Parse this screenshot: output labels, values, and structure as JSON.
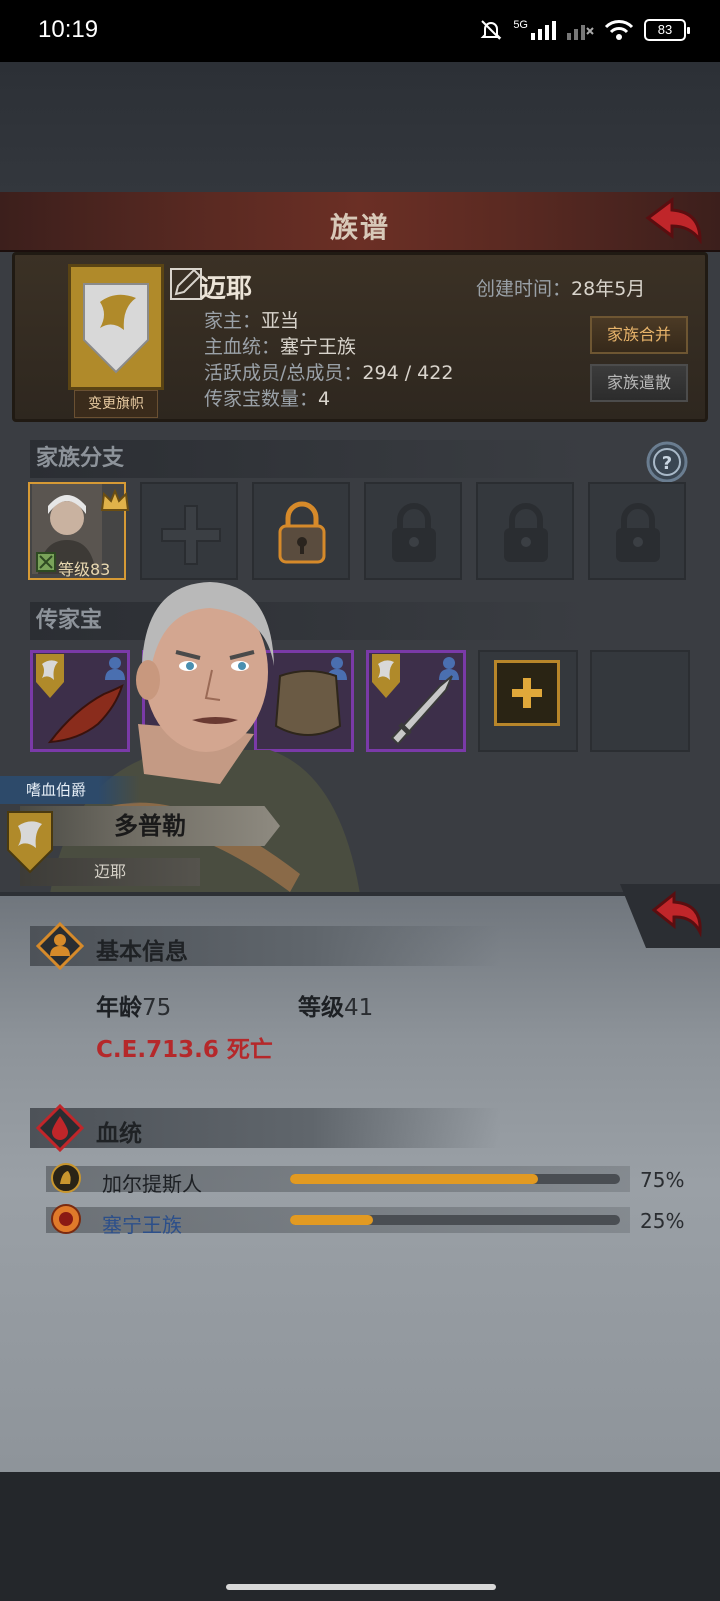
{
  "status_bar": {
    "time": "10:19",
    "network": "5G",
    "battery": "83"
  },
  "header": {
    "title": "族谱"
  },
  "family": {
    "name": "迈耶",
    "change_banner": "变更旗帜",
    "created_label": "创建时间：",
    "created_value": "28年5月",
    "patriarch_label": "家主：",
    "patriarch_value": "亚当",
    "bloodline_label": "主血统：",
    "bloodline_value": "塞宁王族",
    "members_label": "活跃成员/总成员：",
    "members_value": "294 / 422",
    "heirloom_count_label": "传家宝数量：",
    "heirloom_count_value": "4",
    "merge_button": "家族合并",
    "disband_button": "家族遣散"
  },
  "branches": {
    "title": "家族分支",
    "slots": [
      {
        "state": "member",
        "level_label": "等级83"
      },
      {
        "state": "empty"
      },
      {
        "state": "unlockable"
      },
      {
        "state": "locked"
      },
      {
        "state": "locked"
      },
      {
        "state": "locked"
      }
    ]
  },
  "heirlooms": {
    "title": "传家宝",
    "items": [
      "claw-weapon",
      "weapon",
      "armor",
      "sword"
    ]
  },
  "character": {
    "title": "嗜血伯爵",
    "name": "多普勒",
    "family": "迈耶"
  },
  "basic_info": {
    "title": "基本信息",
    "age_label": "年龄",
    "age_value": "75",
    "level_label": "等级",
    "level_value": "41",
    "death_text": "C.E.713.6 死亡"
  },
  "bloodline": {
    "title": "血统",
    "rows": [
      {
        "name": "加尔提斯人",
        "percent": "75%",
        "fill": 0.75,
        "color": "#1d2024"
      },
      {
        "name": "塞宁王族",
        "percent": "25%",
        "fill": 0.25,
        "color": "#2c4f8a"
      }
    ]
  }
}
